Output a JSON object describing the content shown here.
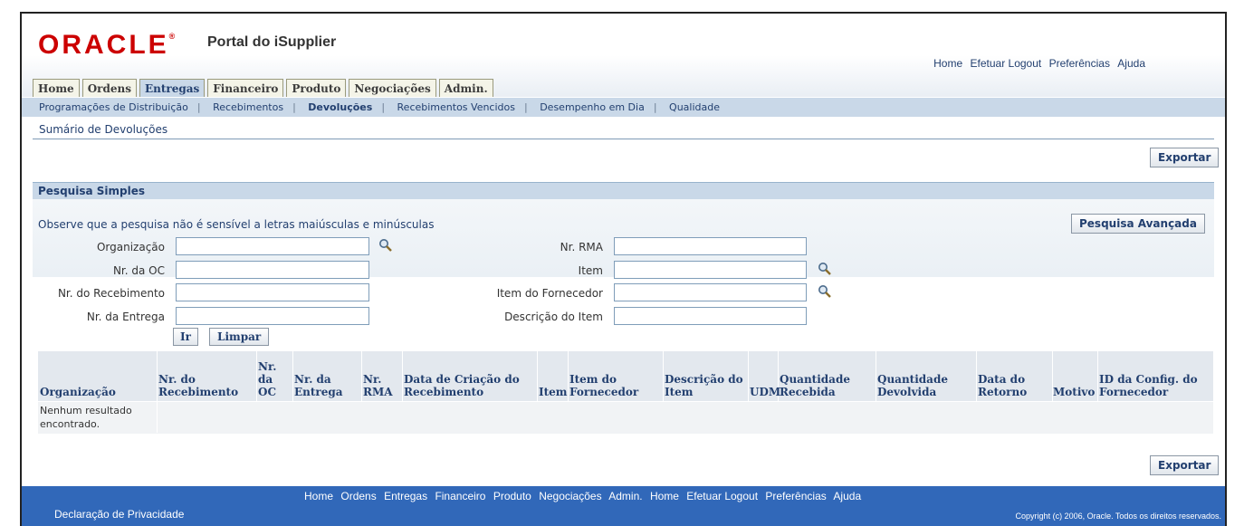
{
  "brand": {
    "logo": "ORACLE",
    "logo_mark": "®",
    "app_title": "Portal do iSupplier"
  },
  "global_links": [
    "Home",
    "Efetuar Logout",
    "Preferências",
    "Ajuda"
  ],
  "tabs": [
    "Home",
    "Ordens",
    "Entregas",
    "Financeiro",
    "Produto",
    "Negociações",
    "Admin."
  ],
  "active_tab": "Entregas",
  "subtabs": [
    "Programações de Distribuição",
    "Recebimentos",
    "Devoluções",
    "Recebimentos Vencidos",
    "Desempenho em Dia",
    "Qualidade"
  ],
  "selected_subtab": "Devoluções",
  "page": {
    "title": "Sumário de Devoluções",
    "export_label": "Exportar"
  },
  "search": {
    "header": "Pesquisa Simples",
    "note": "Observe que a pesquisa não é sensível a letras maiúsculas e minúsculas",
    "advanced_label": "Pesquisa Avançada",
    "fields_left": [
      {
        "label": "Organização",
        "value": "",
        "lov": true
      },
      {
        "label": "Nr. da OC",
        "value": "",
        "lov": false
      },
      {
        "label": "Nr. do Recebimento",
        "value": "",
        "lov": false
      },
      {
        "label": "Nr. da Entrega",
        "value": "",
        "lov": false
      }
    ],
    "fields_right": [
      {
        "label": "Nr. RMA",
        "value": "",
        "lov": false
      },
      {
        "label": "Item",
        "value": "",
        "lov": true
      },
      {
        "label": "Item do Fornecedor",
        "value": "",
        "lov": true
      },
      {
        "label": "Descrição do Item",
        "value": "",
        "lov": false
      }
    ],
    "go_label": "Ir",
    "clear_label": "Limpar"
  },
  "table": {
    "columns": [
      "Organização",
      "Nr. do Recebimento",
      "Nr. da OC",
      "Nr. da Entrega",
      "Nr. RMA",
      "Data de Criação do Recebimento",
      "Item",
      "Item do Fornecedor",
      "Descrição do Item",
      "UDM",
      "Quantidade Recebida",
      "Quantidade Devolvida",
      "Data do Retorno",
      "Motivo",
      "ID da Config. do Fornecedor"
    ],
    "empty_text": "Nenhum resultado encontrado."
  },
  "footer": {
    "links": [
      "Home",
      "Ordens",
      "Entregas",
      "Financeiro",
      "Produto",
      "Negociações",
      "Admin.",
      "Home",
      "Efetuar Logout",
      "Preferências",
      "Ajuda"
    ],
    "privacy": "Declaração de Privacidade",
    "copyright": "Copyright (c) 2006, Oracle. Todos os direitos reservados."
  },
  "colors": {
    "brand_red": "#cc0000",
    "link_blue": "#223f6f",
    "band_blue": "#c9d8e8",
    "footer_blue": "#3168b9"
  }
}
